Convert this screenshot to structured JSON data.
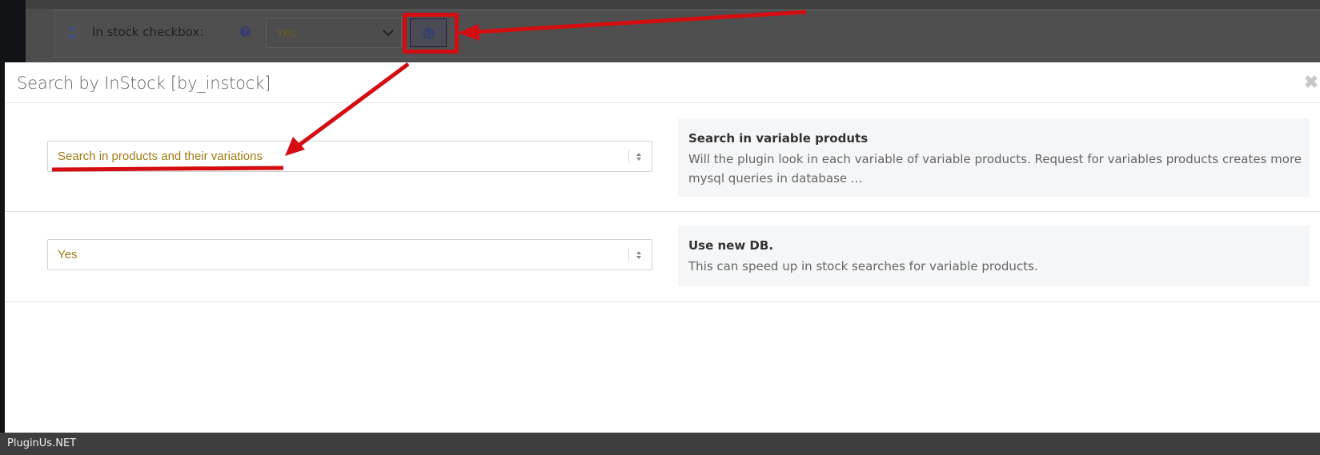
{
  "background": {
    "field_label": "In stock checkbox:",
    "help_icon": "question-circle-icon",
    "select_value": "Yes",
    "gear_icon": "gear-icon"
  },
  "modal": {
    "title": "Search by InStock [by_instock]",
    "close_icon": "close-icon",
    "options": [
      {
        "select_value": "Search in products and their variations",
        "desc_title": "Search in variable produts",
        "desc_text": "Will the plugin look in each variable of variable products. Request for variables products creates more mysql queries in database ..."
      },
      {
        "select_value": "Yes",
        "desc_title": "Use new DB.",
        "desc_text": "This can speed up in stock searches for variable products."
      }
    ]
  },
  "footer": {
    "brand": "PluginUs.NET"
  },
  "colors": {
    "annotation_red": "#d40d12",
    "select_text": "#a07a14"
  }
}
